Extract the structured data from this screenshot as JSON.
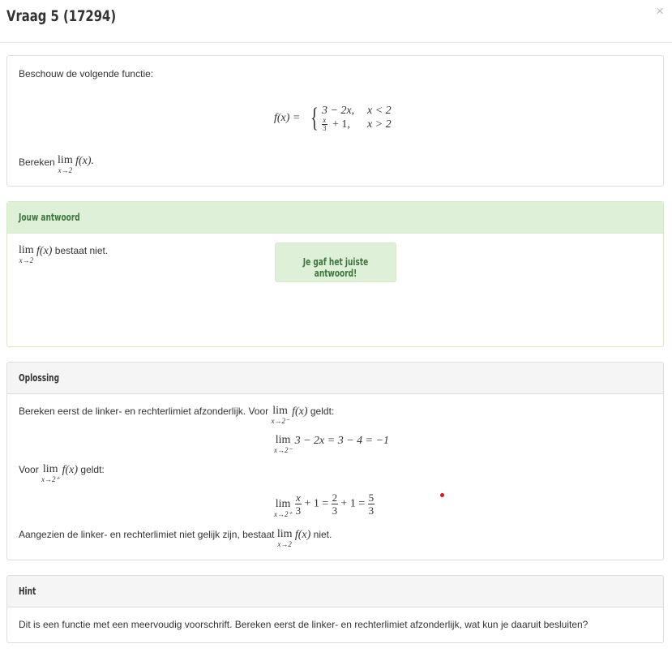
{
  "header": {
    "title": "Vraag 5 (17294)",
    "close_label": "×"
  },
  "question": {
    "intro": "Beschouw de volgende functie:",
    "function_lhs": "f(x) =",
    "case1_expr": "3 − 2x,",
    "case1_cond": "x < 2",
    "case2_num": "x",
    "case2_den": "3",
    "case2_rest": "+ 1,",
    "case2_cond": "x > 2",
    "task_prefix": "Bereken",
    "task_lim": "lim",
    "task_sub": "x→2",
    "task_expr": "f(x).",
    "task_suffix": ""
  },
  "answer": {
    "heading": "Jouw antwoord",
    "lim": "lim",
    "sub": "x→2",
    "expr": "f(x)",
    "text": "bestaat niet.",
    "feedback": "Je gaf het juiste antwoord!"
  },
  "solution": {
    "heading": "Oplossing",
    "line1_prefix": "Bereken eerst de linker- en rechterlimiet afzonderlijk. Voor",
    "line1_lim": "lim",
    "line1_sub": "x→2⁻",
    "line1_expr": "f(x)",
    "line1_suffix": "geldt:",
    "eq1_lim": "lim",
    "eq1_sub": "x→2⁻",
    "eq1_expr": "3 − 2x = 3 − 4 = −1",
    "line2_prefix": "Voor",
    "line2_lim": "lim",
    "line2_sub": "x→2⁺",
    "line2_expr": "f(x)",
    "line2_suffix": "geldt:",
    "eq2_lim": "lim",
    "eq2_sub": "x→2⁺",
    "eq2_f1_num": "x",
    "eq2_f1_den": "3",
    "eq2_mid1": "+ 1 =",
    "eq2_f2_num": "2",
    "eq2_f2_den": "3",
    "eq2_mid2": "+ 1 =",
    "eq2_f3_num": "5",
    "eq2_f3_den": "3",
    "line3_prefix": "Aangezien de linker- en rechterlimiet niet gelijk zijn, bestaat",
    "line3_lim": "lim",
    "line3_sub": "x→2",
    "line3_expr": "f(x)",
    "line3_suffix": "niet."
  },
  "hint": {
    "heading": "Hint",
    "text": "Dit is een functie met een meervoudig voorschrift. Bereken eerst de linker- en rechterlimiet afzonderlijk, wat kun je daaruit besluiten?"
  },
  "colors": {
    "success_bg": "#dff0d8",
    "success_text": "#3c763d",
    "heading_bg": "#f5f5f5",
    "border": "#dddddd",
    "dot": "#e0141e"
  }
}
